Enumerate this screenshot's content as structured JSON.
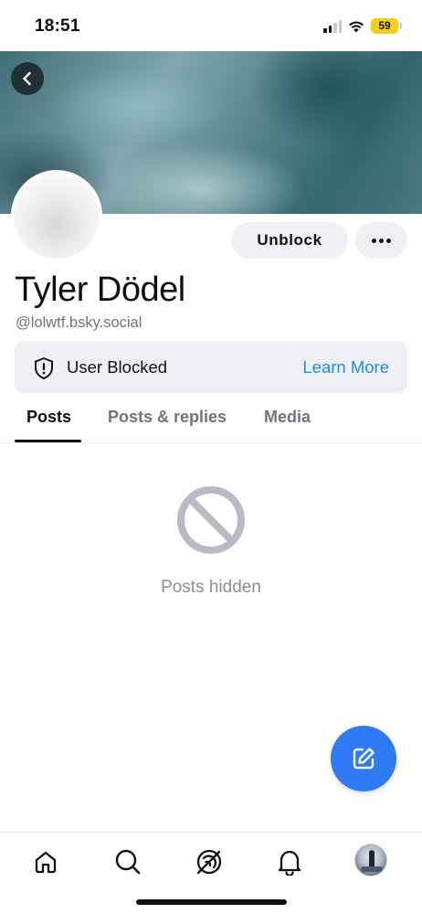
{
  "status_bar": {
    "time": "18:51",
    "battery": "59",
    "battery_color": "#f5cf15"
  },
  "header": {
    "back_icon": "chevron-left-icon"
  },
  "profile": {
    "display_name": "Tyler Dödel",
    "handle": "@lolwtf.bsky.social",
    "unblock_label": "Unblock",
    "more_icon": "ellipsis-icon"
  },
  "blocked_notice": {
    "icon": "shield-alert-icon",
    "label": "User Blocked",
    "link": "Learn More",
    "link_color": "#1d8ef0"
  },
  "tabs": [
    {
      "label": "Posts",
      "active": true
    },
    {
      "label": "Posts & replies",
      "active": false
    },
    {
      "label": "Media",
      "active": false
    }
  ],
  "empty_state": {
    "icon": "prohibited-icon",
    "text": "Posts hidden"
  },
  "fab": {
    "icon": "compose-icon",
    "color": "#2f7bf5"
  },
  "bottom_nav": [
    {
      "icon": "home-icon"
    },
    {
      "icon": "search-icon"
    },
    {
      "icon": "feeds-icon"
    },
    {
      "icon": "bell-icon"
    },
    {
      "icon": "profile-avatar"
    }
  ]
}
